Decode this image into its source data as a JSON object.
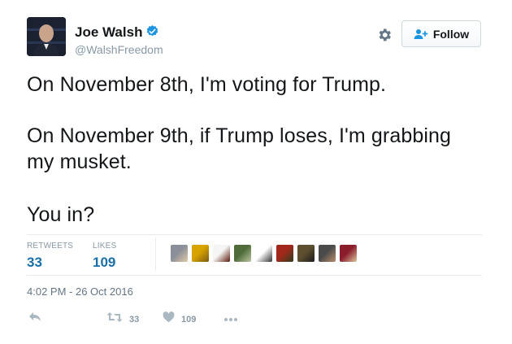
{
  "user": {
    "name": "Joe Walsh",
    "handle": "@WalshFreedom",
    "verified": true
  },
  "header": {
    "follow_label": "Follow",
    "gear_icon": "gear-icon",
    "follow_icon": "person-add-icon"
  },
  "tweet": {
    "lines": [
      "On November 8th, I'm voting for Trump.",
      "On November 9th, if Trump loses, I'm grabbing",
      "my musket.",
      "You in?"
    ]
  },
  "stats": {
    "retweets_label": "RETWEETS",
    "retweets_value": "33",
    "likes_label": "LIKES",
    "likes_value": "109"
  },
  "likers": [
    {
      "icon": "avatar",
      "colors": [
        "#8a8f99",
        "#e3c9a8"
      ]
    },
    {
      "icon": "avatar",
      "colors": [
        "#d6a300",
        "#7a5b12"
      ]
    },
    {
      "icon": "avatar",
      "colors": [
        "#f5f5f5",
        "#5b1a0a"
      ]
    },
    {
      "icon": "avatar",
      "colors": [
        "#4f6b3a",
        "#b9c4a0"
      ]
    },
    {
      "icon": "avatar",
      "colors": [
        "#ffffff",
        "#333333"
      ]
    },
    {
      "icon": "avatar",
      "colors": [
        "#a3281c",
        "#2d3f1c"
      ]
    },
    {
      "icon": "avatar",
      "colors": [
        "#5e4f2f",
        "#1d1d1d"
      ]
    },
    {
      "icon": "avatar",
      "colors": [
        "#4a4a4a",
        "#b88c6c"
      ]
    },
    {
      "icon": "avatar",
      "colors": [
        "#8b1c2c",
        "#d9c79d"
      ]
    }
  ],
  "timestamp": "4:02 PM - 26 Oct 2016",
  "actions": {
    "reply_icon": "reply-icon",
    "retweet_icon": "retweet-icon",
    "retweet_count": "33",
    "like_icon": "heart-icon",
    "like_count": "109",
    "more_icon": "more-dots-icon"
  },
  "colors": {
    "accent": "#1b95e0",
    "stat_value": "#1b6fa8",
    "muted": "#8899a6"
  }
}
